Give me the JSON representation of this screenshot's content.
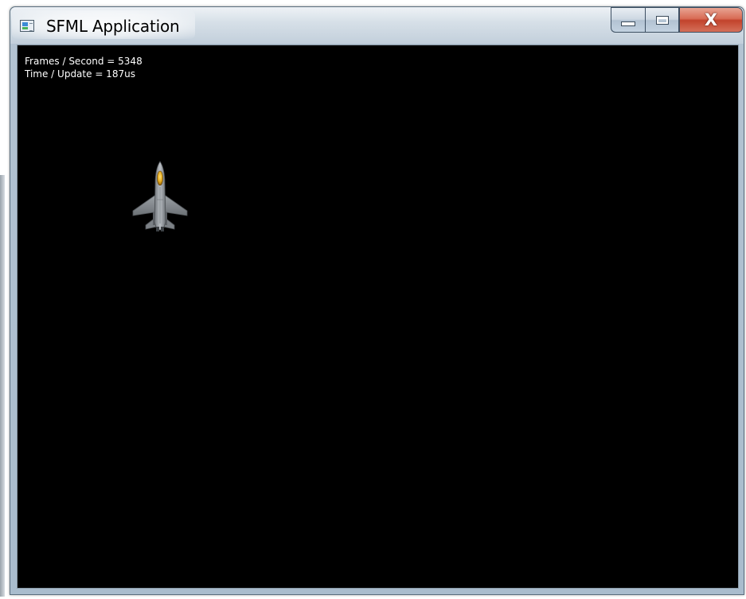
{
  "window": {
    "title": "SFML Application",
    "icon": "window-app-icon",
    "controls": {
      "minimize_icon": "minimize-icon",
      "maximize_icon": "maximize-icon",
      "close_label": "X"
    }
  },
  "hud": {
    "fps_line": "Frames / Second = 5348",
    "update_line": "Time / Update = 187us"
  },
  "scene": {
    "background_color": "#000000",
    "sprite": "fighter-jet-icon"
  }
}
